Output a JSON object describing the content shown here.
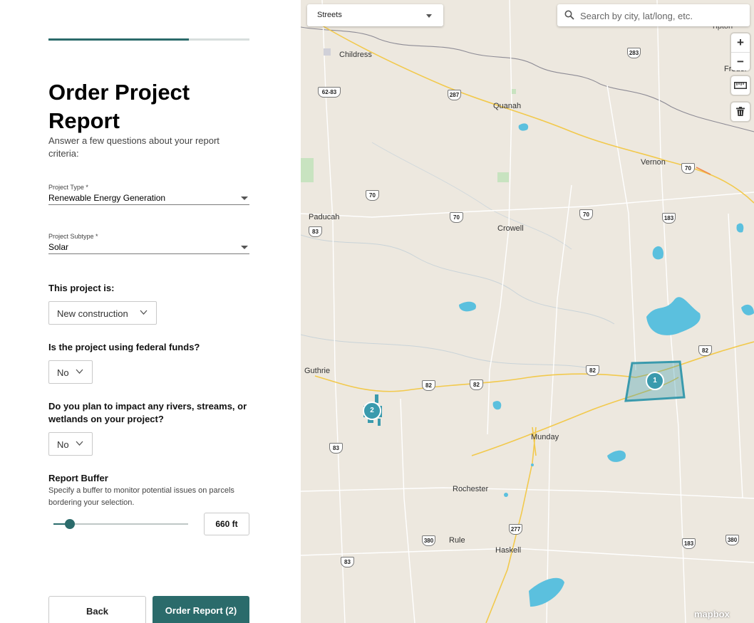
{
  "progress": {
    "value": 0.7
  },
  "header": {
    "title": "Order Project Report",
    "subtitle": "Answer a few questions about your report criteria:"
  },
  "project_type": {
    "label": "Project Type *",
    "value": "Renewable Energy Generation"
  },
  "project_subtype": {
    "label": "Project Subtype *",
    "value": "Solar"
  },
  "questions": {
    "project_is": {
      "label": "This project is:",
      "value": "New construction"
    },
    "federal_funds": {
      "label": "Is the project using federal funds?",
      "value": "No"
    },
    "waters": {
      "label": "Do you plan to impact any rivers, streams, or wetlands on your project?",
      "value": "No"
    }
  },
  "buffer": {
    "title": "Report Buffer",
    "description": "Specify a buffer to monitor potential issues on parcels bordering your selection.",
    "value": "660 ft",
    "slider_fraction": 0.12
  },
  "actions": {
    "back": "Back",
    "order": "Order Report (2)"
  },
  "map": {
    "style_select": "Streets",
    "search_placeholder": "Search by city, lat/long, etc.",
    "zoom_in": "+",
    "zoom_out": "−",
    "towns": {
      "childress": "Childress",
      "quanah": "Quanah",
      "vernon": "Vernon",
      "paducah": "Paducah",
      "crowell": "Crowell",
      "guthrie": "Guthrie",
      "munday": "Munday",
      "rochester": "Rochester",
      "rule": "Rule",
      "haskell": "Haskell",
      "frederick": "Freder",
      "tipton": "Tipton"
    },
    "routes": {
      "r6283": "62-83",
      "r287": "287",
      "r283": "283",
      "r70a": "70",
      "r70b": "70",
      "r70c": "70",
      "r70d": "70",
      "r83a": "83",
      "r83b": "83",
      "r83c": "83",
      "r183a": "183",
      "r183b": "183",
      "r82a": "82",
      "r82b": "82",
      "r82c": "82",
      "r82d": "82",
      "r277": "277",
      "r380a": "380",
      "r380b": "380"
    },
    "clusters": [
      "1",
      "2"
    ],
    "attribution": "mapbox",
    "colors": {
      "water": "#5bc0de",
      "land": "#ede8df",
      "selection": "#3a9aad",
      "brand": "#2b6b6b"
    }
  }
}
